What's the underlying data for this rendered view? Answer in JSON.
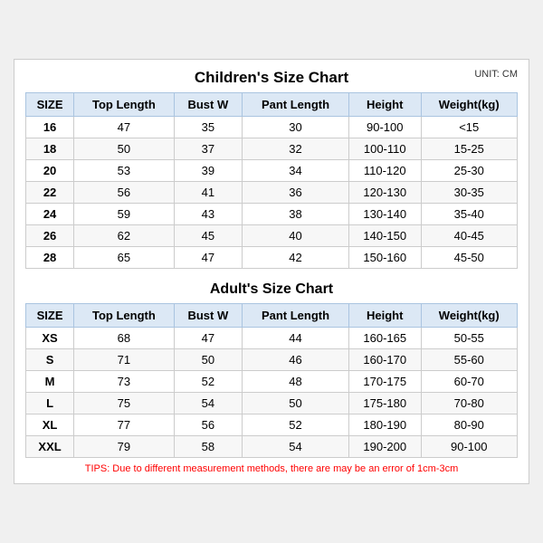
{
  "title": "Children's Size Chart",
  "unit": "UNIT: CM",
  "children_headers": [
    "SIZE",
    "Top Length",
    "Bust W",
    "Pant Length",
    "Height",
    "Weight(kg)"
  ],
  "children_rows": [
    [
      "16",
      "47",
      "35",
      "30",
      "90-100",
      "<15"
    ],
    [
      "18",
      "50",
      "37",
      "32",
      "100-110",
      "15-25"
    ],
    [
      "20",
      "53",
      "39",
      "34",
      "110-120",
      "25-30"
    ],
    [
      "22",
      "56",
      "41",
      "36",
      "120-130",
      "30-35"
    ],
    [
      "24",
      "59",
      "43",
      "38",
      "130-140",
      "35-40"
    ],
    [
      "26",
      "62",
      "45",
      "40",
      "140-150",
      "40-45"
    ],
    [
      "28",
      "65",
      "47",
      "42",
      "150-160",
      "45-50"
    ]
  ],
  "adult_title": "Adult's Size Chart",
  "adult_headers": [
    "SIZE",
    "Top Length",
    "Bust W",
    "Pant Length",
    "Height",
    "Weight(kg)"
  ],
  "adult_rows": [
    [
      "XS",
      "68",
      "47",
      "44",
      "160-165",
      "50-55"
    ],
    [
      "S",
      "71",
      "50",
      "46",
      "160-170",
      "55-60"
    ],
    [
      "M",
      "73",
      "52",
      "48",
      "170-175",
      "60-70"
    ],
    [
      "L",
      "75",
      "54",
      "50",
      "175-180",
      "70-80"
    ],
    [
      "XL",
      "77",
      "56",
      "52",
      "180-190",
      "80-90"
    ],
    [
      "XXL",
      "79",
      "58",
      "54",
      "190-200",
      "90-100"
    ]
  ],
  "tips": "TIPS: Due to different measurement methods, there are may be an error of 1cm-3cm"
}
